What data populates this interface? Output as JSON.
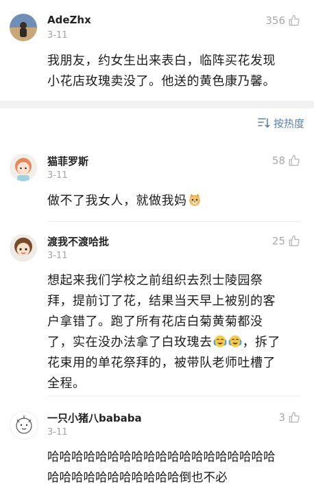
{
  "comments": [
    {
      "username": "AdeZhx",
      "date": "3-11",
      "likes": "356",
      "text_lines": [
        "我朋友，约女生出来表白，临阵买花发现",
        "小花店玫瑰卖没了。他送的黄色康乃馨。"
      ],
      "avatar_icon": "photo-avatar-icon"
    },
    {
      "username": "猫菲罗斯",
      "date": "3-11",
      "likes": "58",
      "text_prefix": "做不了我女人，就做我妈",
      "emoji": "doge-emoji-icon",
      "avatar_icon": "anime-girl-avatar-icon"
    },
    {
      "username": "渡我不渡哈批",
      "date": "3-11",
      "likes": "25",
      "text_lines": [
        "想起来我们学校之前组织去烈士陵园祭",
        "拜，提前订了花，结果当天早上被别的客",
        "户拿错了。跑了所有花店白菊黄菊都没",
        "了，实在没办法拿了白玫瑰去",
        "，拆了",
        "花束用的单花祭拜的，被带队老师吐槽了",
        "全程。"
      ],
      "emoji": "crying-laugh-emoji-icon",
      "avatar_icon": "anime-boy-avatar-icon"
    },
    {
      "username": "一只小猪八bababa",
      "date": "3-11",
      "likes": "3",
      "text_lines": [
        "哈哈哈哈哈哈哈哈哈哈哈哈哈哈哈哈哈哈哈",
        "哈哈哈哈哈哈哈哈哈哈哈倒也不必"
      ],
      "avatar_icon": "sketch-character-avatar-icon"
    }
  ],
  "sort": {
    "label": "按热度",
    "icon": "sort-lines-icon"
  },
  "icons": {
    "like": "thumbs-up-icon"
  },
  "colors": {
    "accent": "#5a7fa8",
    "muted": "#a3a3a3",
    "divider": "#f2f2f2"
  }
}
